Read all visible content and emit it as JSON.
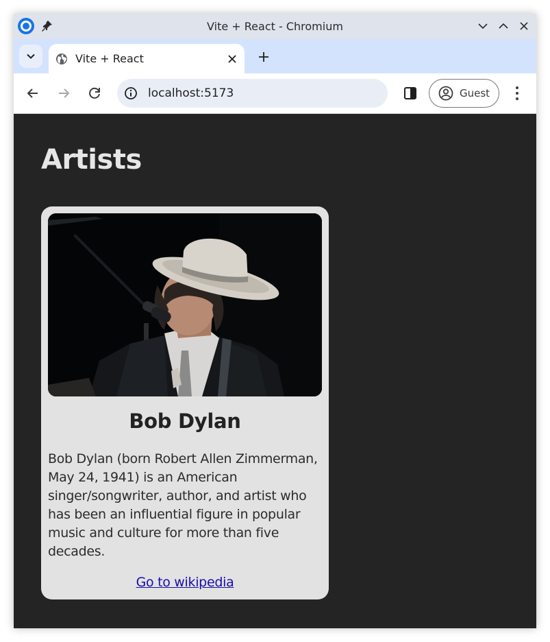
{
  "window": {
    "title": "Vite + React - Chromium"
  },
  "tab": {
    "title": "Vite + React"
  },
  "toolbar": {
    "url": "localhost:5173",
    "profile_label": "Guest"
  },
  "page": {
    "heading": "Artists",
    "artist": {
      "name": "Bob Dylan",
      "bio": "Bob Dylan (born Robert Allen Zimmerman, May 24, 1941) is an American singer/songwriter, author, and artist who has been an influential figure in popular music and culture for more than five decades.",
      "link_label": "Go to wikipedia"
    }
  },
  "icons": {
    "app": "chromium-logo-icon",
    "pin": "pin-icon",
    "minimize": "chevron-down-icon",
    "maximize": "chevron-up-icon",
    "close": "close-icon",
    "tab_search": "chevron-down-icon",
    "tab_favicon": "globe-icon",
    "tab_close": "close-icon",
    "new_tab": "plus-icon",
    "back": "arrow-left-icon",
    "forward": "arrow-right-icon",
    "reload": "reload-icon",
    "site_info": "info-icon",
    "side_panel": "side-panel-icon",
    "profile": "account-circle-icon",
    "menu": "more-vert-icon"
  },
  "colors": {
    "page_background": "#242424",
    "card_background": "#e2e2e2",
    "link": "#1a0dab",
    "tabstrip": "#d3e3fd"
  }
}
